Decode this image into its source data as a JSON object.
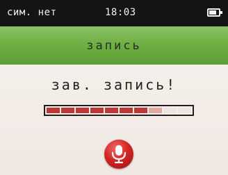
{
  "status": {
    "carrier": "сим. нет",
    "time": "18:03",
    "battery_level": 0.8
  },
  "header": {
    "title": "запись"
  },
  "main": {
    "message": "зав. запись!",
    "progress": {
      "segments_total": 10,
      "filled_segments": 7,
      "fill_color": "#c03535",
      "partial_color": "#e2a9a2",
      "empty_color": "#efe4df"
    },
    "mic_icon": "microphone-icon",
    "mic_color": "#d42525"
  }
}
